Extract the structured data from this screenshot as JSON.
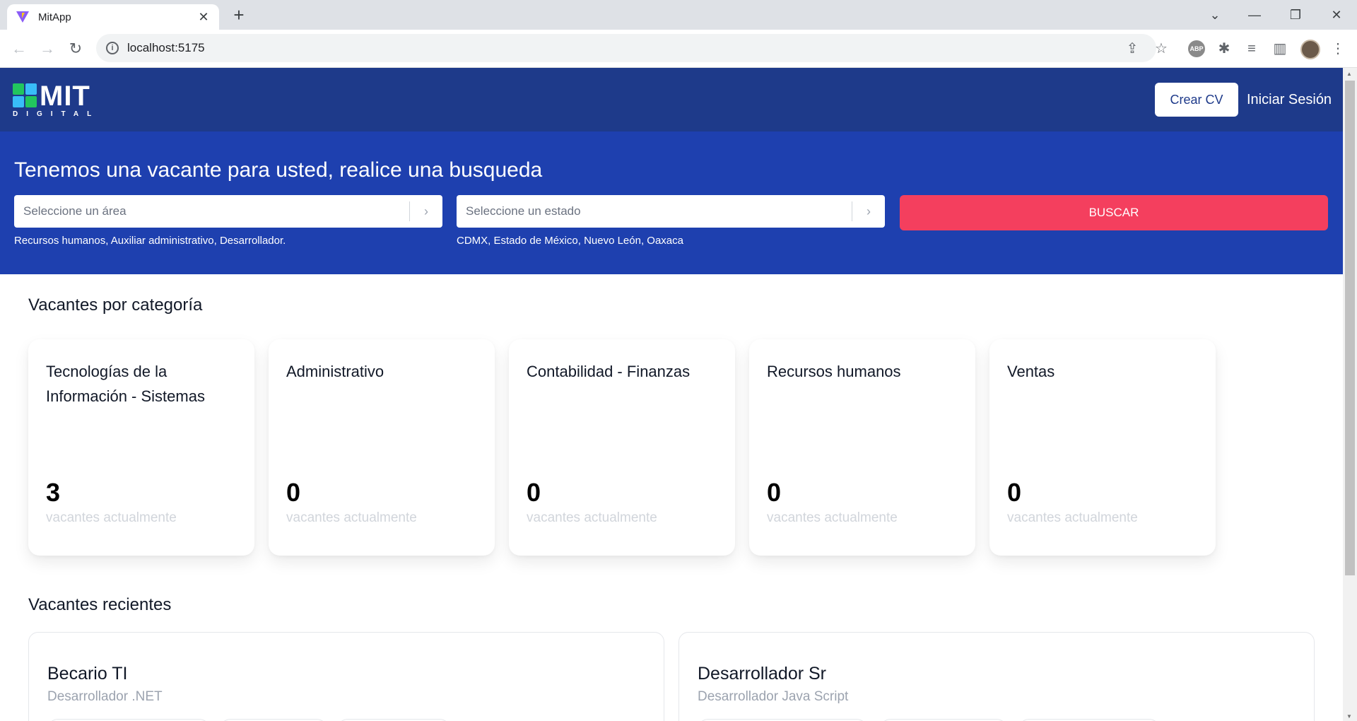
{
  "browser": {
    "tab_title": "MitApp",
    "tab_close": "✕",
    "new_tab": "+",
    "url": "localhost:5175",
    "controls": {
      "chevron": "⌄",
      "minimize": "—",
      "restore": "❐",
      "close": "✕"
    },
    "nav": {
      "back": "←",
      "forward": "→",
      "reload": "↻"
    },
    "ext_abp": "ABP"
  },
  "header": {
    "logo_text": "MIT",
    "logo_subtext": "DIGITAL",
    "crear_cv": "Crear CV",
    "login": "Iniciar Sesión"
  },
  "hero": {
    "title": "Tenemos una vacante para usted, realice una busqueda",
    "area_placeholder": "Seleccione un área",
    "area_hint": "Recursos humanos, Auxiliar administrativo, Desarrollador.",
    "estado_placeholder": "Seleccione un estado",
    "estado_hint": "CDMX, Estado de México, Nuevo León, Oaxaca",
    "search_button": "BUSCAR",
    "arrow": "›"
  },
  "categories_section": {
    "title": "Vacantes por categoría",
    "items": [
      {
        "name": "Tecnologías de la Información - Sistemas",
        "count": "3",
        "sub": "vacantes actualmente"
      },
      {
        "name": "Administrativo",
        "count": "0",
        "sub": "vacantes actualmente"
      },
      {
        "name": "Contabilidad - Finanzas",
        "count": "0",
        "sub": "vacantes actualmente"
      },
      {
        "name": "Recursos humanos",
        "count": "0",
        "sub": "vacantes actualmente"
      },
      {
        "name": "Ventas",
        "count": "0",
        "sub": "vacantes actualmente"
      }
    ]
  },
  "recent_section": {
    "title": "Vacantes recientes",
    "jobs": [
      {
        "title": "Becario TI",
        "subtitle": "Desarrollador .NET"
      },
      {
        "title": "Desarrollador Sr",
        "subtitle": "Desarrollador Java Script"
      }
    ]
  },
  "colors": {
    "header_bg": "#1e3a8a",
    "hero_bg": "#1e40af",
    "search_button": "#f43f5e"
  }
}
